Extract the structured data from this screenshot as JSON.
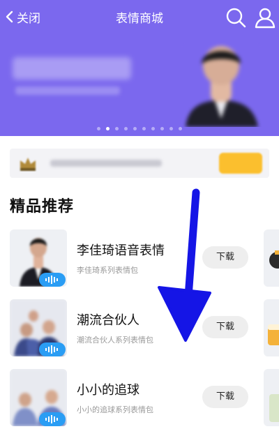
{
  "navbar": {
    "back_label": "关闭",
    "title": "表情商城",
    "search_icon": "search-icon",
    "user_icon": "user-icon"
  },
  "colors": {
    "header_bg": "#7b68ee",
    "download_bg": "#eeeeee",
    "voice_badge": "#2a9df4",
    "arrow": "#1515e6",
    "notice_button": "#fbbf2e"
  },
  "banner": {
    "dots_count": 10,
    "active_dot": 1
  },
  "section": {
    "title": "精品推荐"
  },
  "items": [
    {
      "name": "李佳琦语音表情",
      "desc": "李佳琦系列表情包",
      "button": "下载"
    },
    {
      "name": "潮流合伙人",
      "desc": "潮流合伙人系列表情包",
      "button": "下载"
    },
    {
      "name": "小小的追球",
      "desc": "小小的追球系列表情包",
      "button": "下载"
    }
  ]
}
